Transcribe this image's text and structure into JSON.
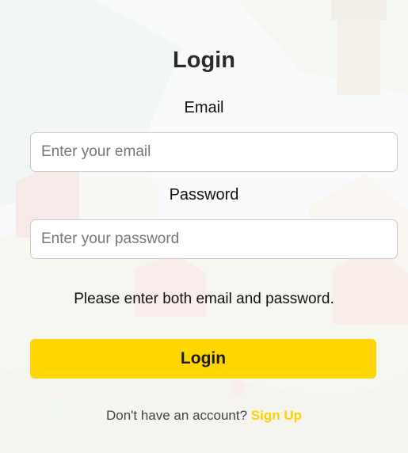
{
  "login_form": {
    "title": "Login",
    "email_label": "Email",
    "email_placeholder": "Enter your email",
    "email_value": "",
    "password_label": "Password",
    "password_placeholder": "Enter your password",
    "password_value": "",
    "validation_message": "Please enter both email and password.",
    "login_button_label": "Login",
    "signup_prompt": "Don't have an account?",
    "signup_link_label": "Sign Up"
  },
  "colors": {
    "accent": "#ffd600",
    "link": "#ffd000",
    "title": "#2b2b2b"
  }
}
